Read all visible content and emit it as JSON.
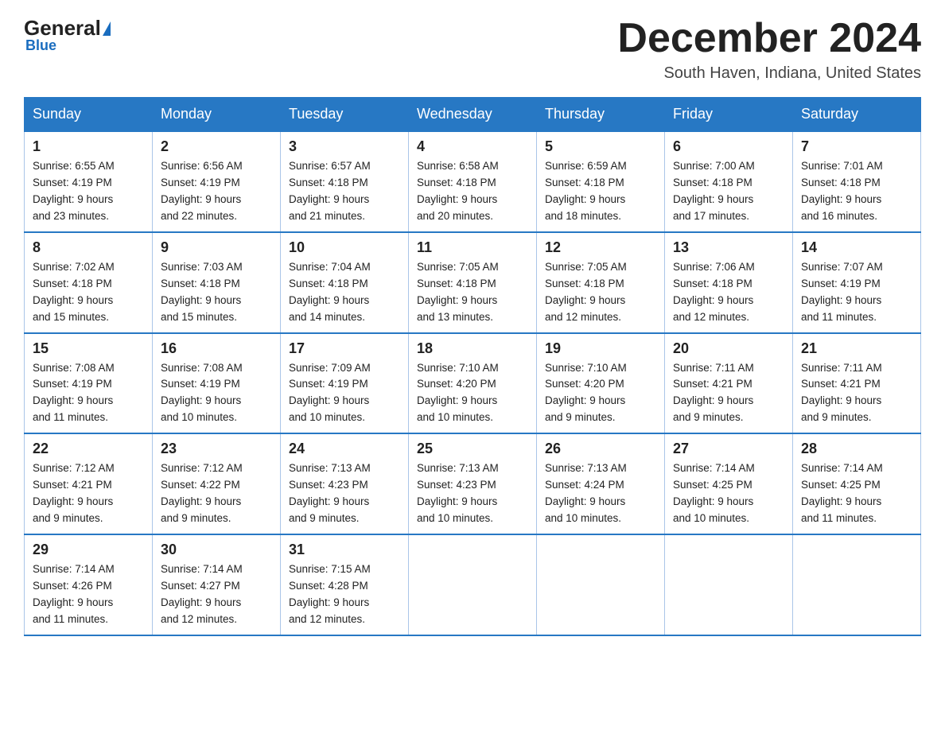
{
  "header": {
    "logo_general": "General",
    "logo_blue": "Blue",
    "month_title": "December 2024",
    "location": "South Haven, Indiana, United States"
  },
  "weekdays": [
    "Sunday",
    "Monday",
    "Tuesday",
    "Wednesday",
    "Thursday",
    "Friday",
    "Saturday"
  ],
  "weeks": [
    [
      {
        "day": "1",
        "sunrise": "6:55 AM",
        "sunset": "4:19 PM",
        "daylight": "9 hours and 23 minutes."
      },
      {
        "day": "2",
        "sunrise": "6:56 AM",
        "sunset": "4:19 PM",
        "daylight": "9 hours and 22 minutes."
      },
      {
        "day": "3",
        "sunrise": "6:57 AM",
        "sunset": "4:18 PM",
        "daylight": "9 hours and 21 minutes."
      },
      {
        "day": "4",
        "sunrise": "6:58 AM",
        "sunset": "4:18 PM",
        "daylight": "9 hours and 20 minutes."
      },
      {
        "day": "5",
        "sunrise": "6:59 AM",
        "sunset": "4:18 PM",
        "daylight": "9 hours and 18 minutes."
      },
      {
        "day": "6",
        "sunrise": "7:00 AM",
        "sunset": "4:18 PM",
        "daylight": "9 hours and 17 minutes."
      },
      {
        "day": "7",
        "sunrise": "7:01 AM",
        "sunset": "4:18 PM",
        "daylight": "9 hours and 16 minutes."
      }
    ],
    [
      {
        "day": "8",
        "sunrise": "7:02 AM",
        "sunset": "4:18 PM",
        "daylight": "9 hours and 15 minutes."
      },
      {
        "day": "9",
        "sunrise": "7:03 AM",
        "sunset": "4:18 PM",
        "daylight": "9 hours and 15 minutes."
      },
      {
        "day": "10",
        "sunrise": "7:04 AM",
        "sunset": "4:18 PM",
        "daylight": "9 hours and 14 minutes."
      },
      {
        "day": "11",
        "sunrise": "7:05 AM",
        "sunset": "4:18 PM",
        "daylight": "9 hours and 13 minutes."
      },
      {
        "day": "12",
        "sunrise": "7:05 AM",
        "sunset": "4:18 PM",
        "daylight": "9 hours and 12 minutes."
      },
      {
        "day": "13",
        "sunrise": "7:06 AM",
        "sunset": "4:18 PM",
        "daylight": "9 hours and 12 minutes."
      },
      {
        "day": "14",
        "sunrise": "7:07 AM",
        "sunset": "4:19 PM",
        "daylight": "9 hours and 11 minutes."
      }
    ],
    [
      {
        "day": "15",
        "sunrise": "7:08 AM",
        "sunset": "4:19 PM",
        "daylight": "9 hours and 11 minutes."
      },
      {
        "day": "16",
        "sunrise": "7:08 AM",
        "sunset": "4:19 PM",
        "daylight": "9 hours and 10 minutes."
      },
      {
        "day": "17",
        "sunrise": "7:09 AM",
        "sunset": "4:19 PM",
        "daylight": "9 hours and 10 minutes."
      },
      {
        "day": "18",
        "sunrise": "7:10 AM",
        "sunset": "4:20 PM",
        "daylight": "9 hours and 10 minutes."
      },
      {
        "day": "19",
        "sunrise": "7:10 AM",
        "sunset": "4:20 PM",
        "daylight": "9 hours and 9 minutes."
      },
      {
        "day": "20",
        "sunrise": "7:11 AM",
        "sunset": "4:21 PM",
        "daylight": "9 hours and 9 minutes."
      },
      {
        "day": "21",
        "sunrise": "7:11 AM",
        "sunset": "4:21 PM",
        "daylight": "9 hours and 9 minutes."
      }
    ],
    [
      {
        "day": "22",
        "sunrise": "7:12 AM",
        "sunset": "4:21 PM",
        "daylight": "9 hours and 9 minutes."
      },
      {
        "day": "23",
        "sunrise": "7:12 AM",
        "sunset": "4:22 PM",
        "daylight": "9 hours and 9 minutes."
      },
      {
        "day": "24",
        "sunrise": "7:13 AM",
        "sunset": "4:23 PM",
        "daylight": "9 hours and 9 minutes."
      },
      {
        "day": "25",
        "sunrise": "7:13 AM",
        "sunset": "4:23 PM",
        "daylight": "9 hours and 10 minutes."
      },
      {
        "day": "26",
        "sunrise": "7:13 AM",
        "sunset": "4:24 PM",
        "daylight": "9 hours and 10 minutes."
      },
      {
        "day": "27",
        "sunrise": "7:14 AM",
        "sunset": "4:25 PM",
        "daylight": "9 hours and 10 minutes."
      },
      {
        "day": "28",
        "sunrise": "7:14 AM",
        "sunset": "4:25 PM",
        "daylight": "9 hours and 11 minutes."
      }
    ],
    [
      {
        "day": "29",
        "sunrise": "7:14 AM",
        "sunset": "4:26 PM",
        "daylight": "9 hours and 11 minutes."
      },
      {
        "day": "30",
        "sunrise": "7:14 AM",
        "sunset": "4:27 PM",
        "daylight": "9 hours and 12 minutes."
      },
      {
        "day": "31",
        "sunrise": "7:15 AM",
        "sunset": "4:28 PM",
        "daylight": "9 hours and 12 minutes."
      },
      null,
      null,
      null,
      null
    ]
  ],
  "labels": {
    "sunrise": "Sunrise:",
    "sunset": "Sunset:",
    "daylight": "Daylight:"
  }
}
